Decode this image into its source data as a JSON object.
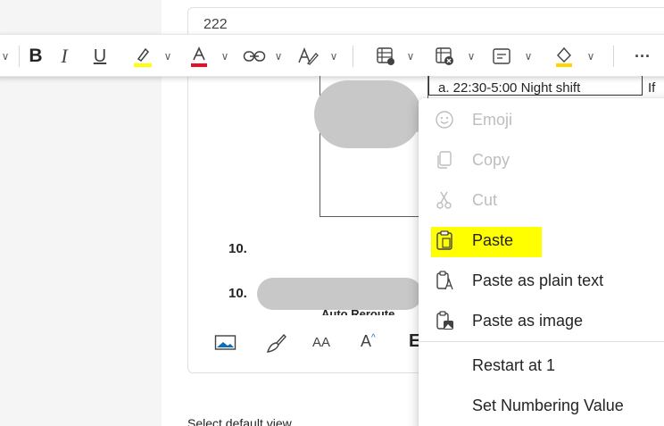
{
  "compose": {
    "subject": "222"
  },
  "toolbar": {
    "items": [
      {
        "name": "bold",
        "glyph": "B"
      },
      {
        "name": "italic",
        "glyph": "I"
      },
      {
        "name": "underline",
        "glyph": "U"
      }
    ],
    "more_glyph": "···",
    "colors": {
      "highlight": "#ffff00",
      "font_color": "#e81123",
      "accent": "#0f6cbd"
    }
  },
  "document": {
    "table_cell_text": "a. 22:30-5:00 Night shift",
    "table_cell_text2": "If",
    "list_number_1": "10.",
    "list_number_2": "10.",
    "clipped_text": "Auto Reroute"
  },
  "bottom_toolbar": {
    "text_size_glyph": "AA",
    "superscript_glyph": "A",
    "more_glyph": "E"
  },
  "bottom_text": "Select default view",
  "context_menu": {
    "items": [
      {
        "label": "Emoji",
        "icon": "emoji-icon",
        "disabled": true
      },
      {
        "label": "Copy",
        "icon": "copy-icon",
        "disabled": true
      },
      {
        "label": "Cut",
        "icon": "scissors-icon",
        "disabled": true
      },
      {
        "label": "Paste",
        "icon": "paste-icon",
        "disabled": false,
        "highlighted": true
      },
      {
        "label": "Paste as plain text",
        "icon": "paste-plain-text-icon",
        "disabled": false
      },
      {
        "label": "Paste as image",
        "icon": "paste-image-icon",
        "disabled": false
      },
      {
        "label": "Restart at 1",
        "icon": "",
        "disabled": false
      },
      {
        "label": "Set Numbering Value",
        "icon": "",
        "disabled": false
      }
    ]
  }
}
